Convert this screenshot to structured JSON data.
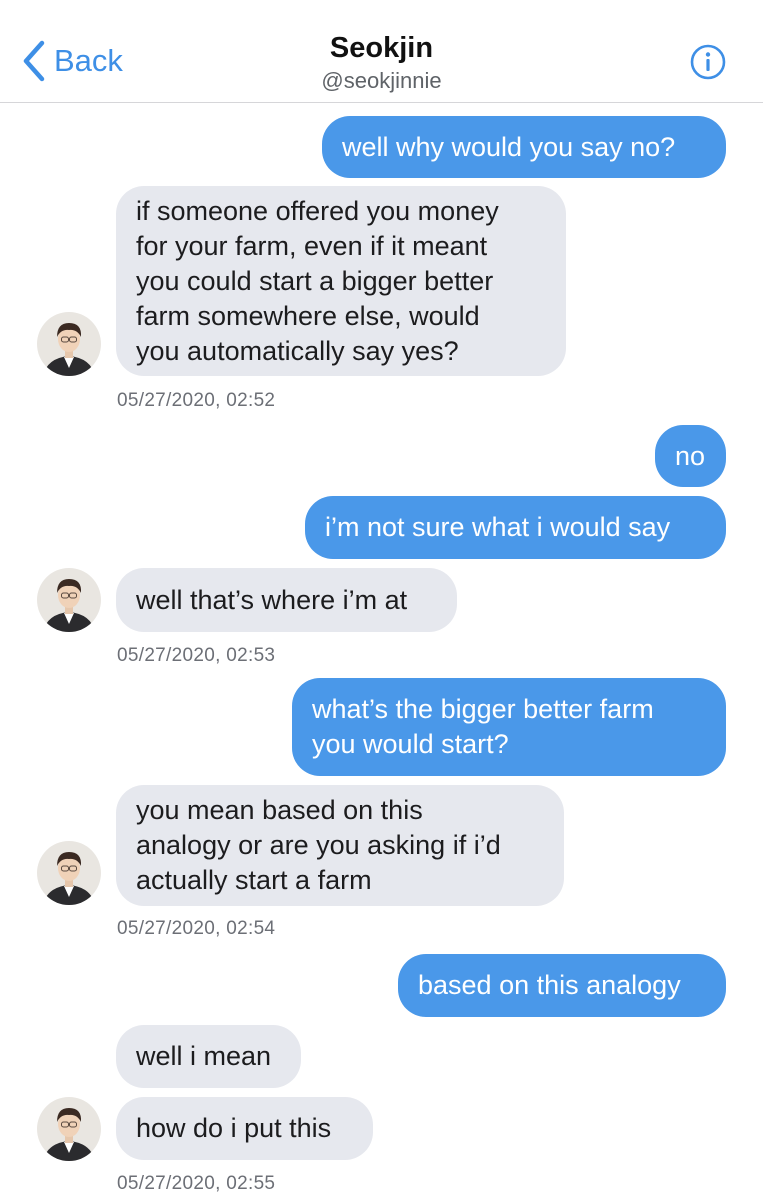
{
  "header": {
    "back_label": "Back",
    "title": "Seokjin",
    "handle": "@seokjinnie"
  },
  "messages": [
    {
      "id": "m1",
      "direction": "outgoing",
      "text": "well why would you say no?"
    },
    {
      "id": "m2",
      "direction": "incoming",
      "text": "if someone offered you money\nfor your farm, even if it meant\nyou could start a bigger better\nfarm somewhere else, would\nyou automatically say yes?"
    },
    {
      "id": "m3",
      "direction": "outgoing",
      "text": "no"
    },
    {
      "id": "m4",
      "direction": "outgoing",
      "text": "i’m not sure what i would say"
    },
    {
      "id": "m5",
      "direction": "incoming",
      "text": "well that’s where i’m at"
    },
    {
      "id": "m6",
      "direction": "outgoing",
      "text": "what’s the bigger better farm\nyou would start?"
    },
    {
      "id": "m7",
      "direction": "incoming",
      "text": "you mean based on this\nanalogy or are you asking if i’d\nactually start a farm"
    },
    {
      "id": "m8",
      "direction": "outgoing",
      "text": "based on this analogy"
    },
    {
      "id": "m9",
      "direction": "incoming",
      "text": "well i mean"
    },
    {
      "id": "m10",
      "direction": "incoming",
      "text": "how do i put this"
    }
  ],
  "timestamps": [
    "05/27/2020, 02:52",
    "05/27/2020, 02:53",
    "05/27/2020, 02:54",
    "05/27/2020, 02:55"
  ],
  "colors": {
    "accent": "#3e8fe6",
    "outgoing_bubble": "#4a98e9",
    "incoming_bubble": "#e6e8ee",
    "timestamp": "#6c6f76"
  },
  "icons": {
    "back": "chevron-left-icon",
    "info": "info-circle-icon",
    "avatar": "profile-photo"
  }
}
